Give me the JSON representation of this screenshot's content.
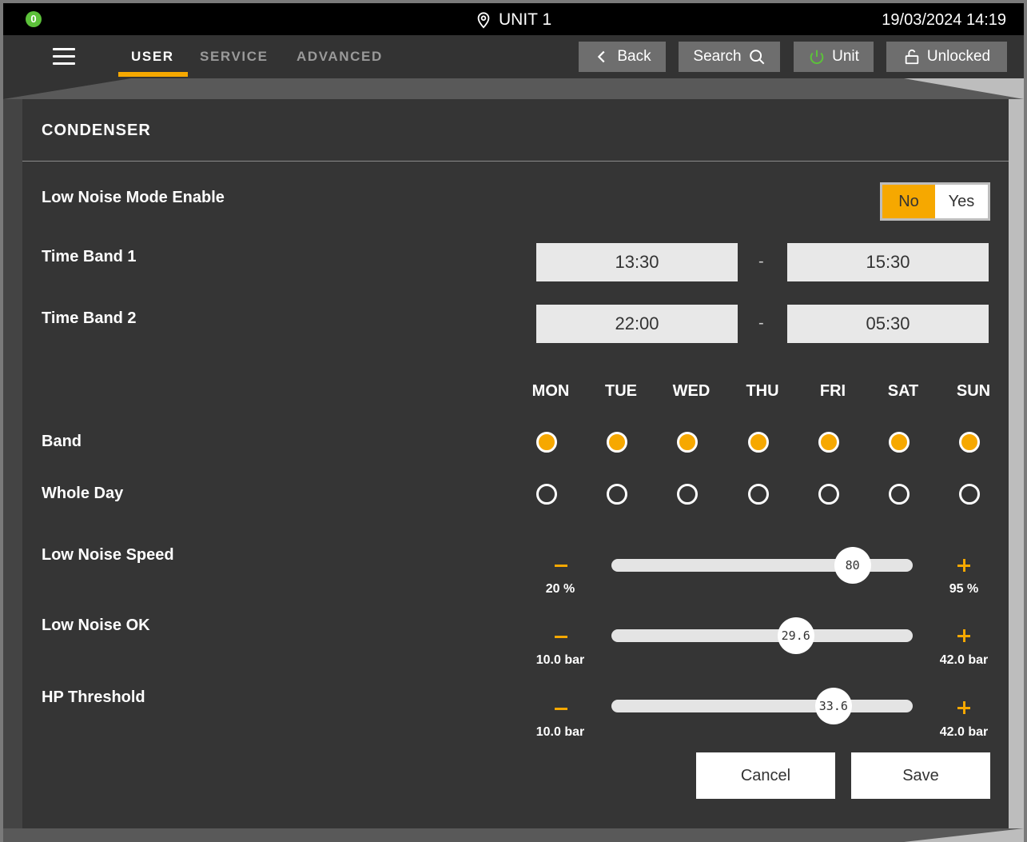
{
  "status_bar": {
    "alarm_count": "0",
    "unit_name": "UNIT 1",
    "datetime": "19/03/2024 14:19"
  },
  "nav": {
    "tabs": [
      "USER",
      "SERVICE",
      "ADVANCED"
    ],
    "active_tab": "USER",
    "buttons": {
      "back": "Back",
      "search": "Search",
      "unit": "Unit",
      "lock": "Unlocked"
    }
  },
  "panel": {
    "title": "CONDENSER",
    "low_noise_mode": {
      "label": "Low Noise Mode Enable",
      "options": [
        "No",
        "Yes"
      ],
      "selected": "No"
    },
    "time_band_1": {
      "label": "Time Band 1",
      "start": "13:30",
      "separator": "-",
      "end": "15:30"
    },
    "time_band_2": {
      "label": "Time Band 2",
      "start": "22:00",
      "separator": "-",
      "end": "05:30"
    },
    "days": [
      "MON",
      "TUE",
      "WED",
      "THU",
      "FRI",
      "SAT",
      "SUN"
    ],
    "band_row": {
      "label": "Band",
      "checked": [
        true,
        true,
        true,
        true,
        true,
        true,
        true
      ]
    },
    "whole_day_row": {
      "label": "Whole Day",
      "checked": [
        false,
        false,
        false,
        false,
        false,
        false,
        false
      ]
    },
    "sliders": [
      {
        "label": "Low Noise Speed",
        "value": "80",
        "min": 20,
        "max": 95,
        "min_label": "20 %",
        "max_label": "95 %",
        "fraction": 0.8
      },
      {
        "label": "Low Noise OK",
        "value": "29.6",
        "min": 10.0,
        "max": 42.0,
        "min_label": "10.0 bar",
        "max_label": "42.0 bar",
        "fraction": 0.612
      },
      {
        "label": "HP Threshold",
        "value": "33.6",
        "min": 10.0,
        "max": 42.0,
        "min_label": "10.0 bar",
        "max_label": "42.0 bar",
        "fraction": 0.737
      }
    ],
    "actions": {
      "cancel": "Cancel",
      "save": "Save"
    }
  },
  "colors": {
    "accent": "#f6a800",
    "status_ok": "#5cc13a",
    "panel_bg": "#353535"
  }
}
